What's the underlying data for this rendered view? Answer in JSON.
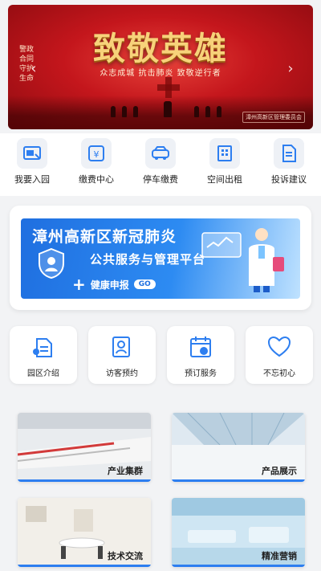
{
  "banner": {
    "title": "致敬英雄",
    "subtitle": "众志成城  抗击肺炎  致敬逆行者",
    "side_text": "警政合同 守护生命",
    "logo_text": "漳州高新区管理委员会"
  },
  "quick_actions": [
    {
      "label": "我要入园",
      "icon": "enter-park-icon"
    },
    {
      "label": "缴费中心",
      "icon": "payment-icon"
    },
    {
      "label": "停车缴费",
      "icon": "parking-icon"
    },
    {
      "label": "空间出租",
      "icon": "building-icon"
    },
    {
      "label": "投诉建议",
      "icon": "complaint-icon"
    }
  ],
  "covid_banner": {
    "title": "漳州高新区新冠肺炎",
    "subtitle": "公共服务与管理平台",
    "report_label": "健康申报",
    "go_label": "GO"
  },
  "services": [
    {
      "label": "园区介绍",
      "icon": "park-intro-icon"
    },
    {
      "label": "访客预约",
      "icon": "visitor-icon"
    },
    {
      "label": "预订服务",
      "icon": "calendar-icon"
    },
    {
      "label": "不忘初心",
      "icon": "heart-icon"
    }
  ],
  "tiles": [
    {
      "label": "产业集群"
    },
    {
      "label": "产品展示"
    },
    {
      "label": "技术交流"
    },
    {
      "label": "精准营销"
    }
  ],
  "colors": {
    "banner_red": "#c4161c",
    "gold": "#f7d27a",
    "primary_blue": "#2d7ef0"
  }
}
